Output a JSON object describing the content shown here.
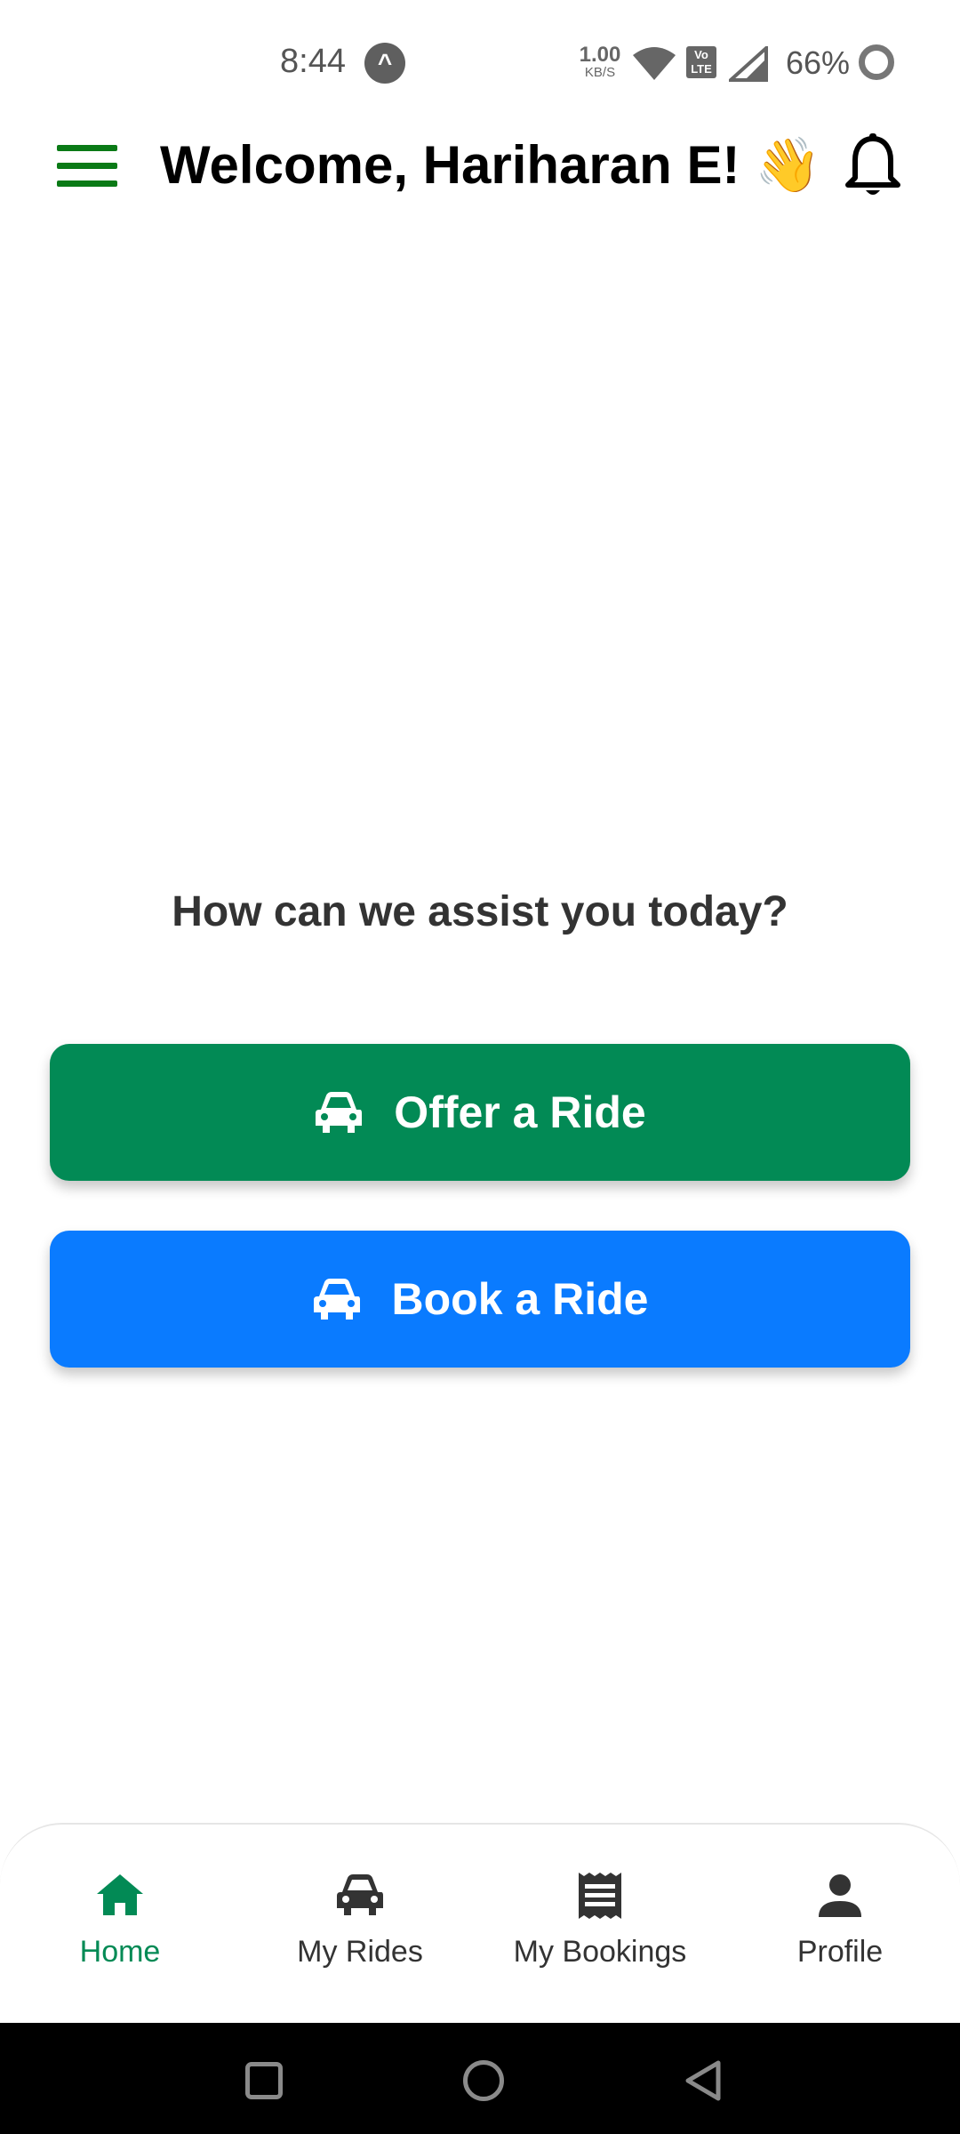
{
  "status_bar": {
    "time": "8:44",
    "app_notification_glyph": "^",
    "net_speed_value": "1.00",
    "net_speed_unit": "KB/S",
    "volte_label": "Vo LTE",
    "battery_percent": "66%"
  },
  "header": {
    "title": "Welcome, Hariharan E! 👋",
    "menu_icon": "hamburger-menu-icon",
    "bell_icon": "bell-icon"
  },
  "main": {
    "prompt": "How can we assist you today?",
    "offer_button": {
      "label": "Offer a Ride",
      "icon": "car-icon",
      "color": "#028a55"
    },
    "book_button": {
      "label": "Book a Ride",
      "icon": "car-icon",
      "color": "#0a7bff"
    }
  },
  "bottom_nav": {
    "active_color": "#028a55",
    "items": [
      {
        "label": "Home",
        "icon": "home-icon",
        "active": true
      },
      {
        "label": "My Rides",
        "icon": "car-icon",
        "active": false
      },
      {
        "label": "My Bookings",
        "icon": "receipt-icon",
        "active": false
      },
      {
        "label": "Profile",
        "icon": "person-icon",
        "active": false
      }
    ]
  },
  "system_nav": {
    "buttons": [
      "recents-button",
      "home-button",
      "back-button"
    ]
  }
}
